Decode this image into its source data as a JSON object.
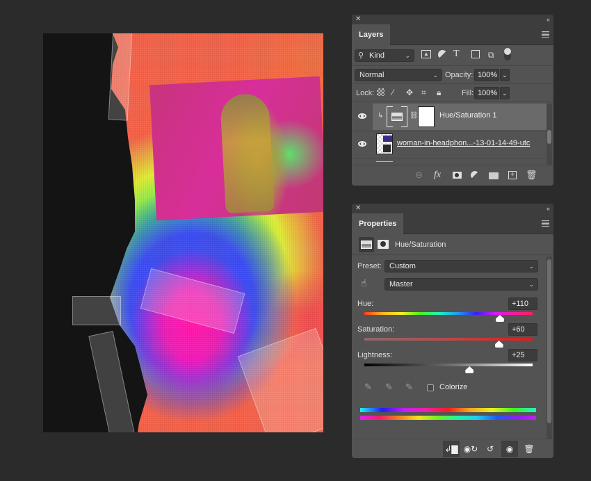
{
  "layers_panel": {
    "close_icon": "close-icon",
    "collapse_icon": "double-chevron-icon",
    "tab_label": "Layers",
    "filter": {
      "kind_label": "Kind",
      "filter_icons": [
        "image-filter-icon",
        "adjustment-filter-icon",
        "type-filter-icon",
        "shape-filter-icon",
        "smart-object-filter-icon",
        "filter-toggle-icon"
      ]
    },
    "blend_mode": "Normal",
    "opacity_label": "Opacity:",
    "opacity_value": "100%",
    "lock_label": "Lock:",
    "fill_label": "Fill:",
    "fill_value": "100%",
    "layers": [
      {
        "name": "Hue/Saturation 1",
        "type": "adjustment",
        "visible": true,
        "selected": true,
        "clipped": true
      },
      {
        "name": "woman-in-headphon...-13-01-14-49-utc",
        "type": "smart-object",
        "visible": true,
        "selected": false
      }
    ],
    "footer_icons": [
      "link-layers-icon",
      "fx-icon",
      "add-mask-icon",
      "new-adjustment-icon",
      "new-group-icon",
      "new-layer-icon",
      "trash-icon"
    ]
  },
  "properties_panel": {
    "tab_label": "Properties",
    "adjustment_title": "Hue/Saturation",
    "preset_label": "Preset:",
    "preset_value": "Custom",
    "channel_value": "Master",
    "sliders": [
      {
        "label": "Hue:",
        "value": "+110",
        "min": -180,
        "max": 180,
        "numeric": 110
      },
      {
        "label": "Saturation:",
        "value": "+60",
        "min": -100,
        "max": 100,
        "numeric": 60
      },
      {
        "label": "Lightness:",
        "value": "+25",
        "min": -100,
        "max": 100,
        "numeric": 25
      }
    ],
    "colorize_label": "Colorize",
    "colorize_checked": false,
    "footer_icons": [
      "clip-to-layer-icon",
      "view-previous-state-icon",
      "reset-icon",
      "toggle-visibility-icon",
      "trash-icon"
    ]
  },
  "colors": {
    "workspace": "#2b2b2b",
    "panel": "#535353",
    "panel_header": "#3d3d3d",
    "selected_layer": "#6a6a6a"
  }
}
